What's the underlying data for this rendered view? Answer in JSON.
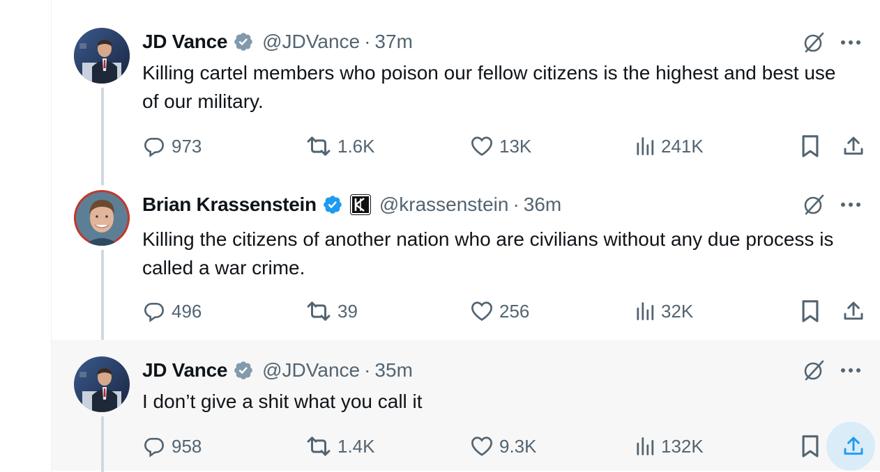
{
  "colors": {
    "accent": "#1d9bf0",
    "muted": "#536471",
    "text": "#0f1419",
    "verified": "#829aab",
    "thread_line": "#cfd9de"
  },
  "tweets": [
    {
      "name": "JD Vance",
      "verified_badge": "gray-verified-icon",
      "handle": "@JDVance",
      "time": "37m",
      "text": "Killing cartel members who poison our fellow citizens is the highest and best use of our military.",
      "replies": "973",
      "retweets": "1.6K",
      "likes": "13K",
      "views": "241K"
    },
    {
      "name": "Brian Krassenstein",
      "verified_badge": "blue-verified-icon",
      "affiliate_icon": "k-affiliate-icon",
      "handle": "@krassenstein",
      "time": "36m",
      "text": "Killing the citizens of another nation who are civilians without any due process is called a war crime.",
      "replies": "496",
      "retweets": "39",
      "likes": "256",
      "views": "32K"
    },
    {
      "name": "JD Vance",
      "verified_badge": "gray-verified-icon",
      "handle": "@JDVance",
      "time": "35m",
      "text": "I don’t give a shit what you call it",
      "replies": "958",
      "retweets": "1.4K",
      "likes": "9.3K",
      "views": "132K"
    }
  ],
  "separator": "·"
}
